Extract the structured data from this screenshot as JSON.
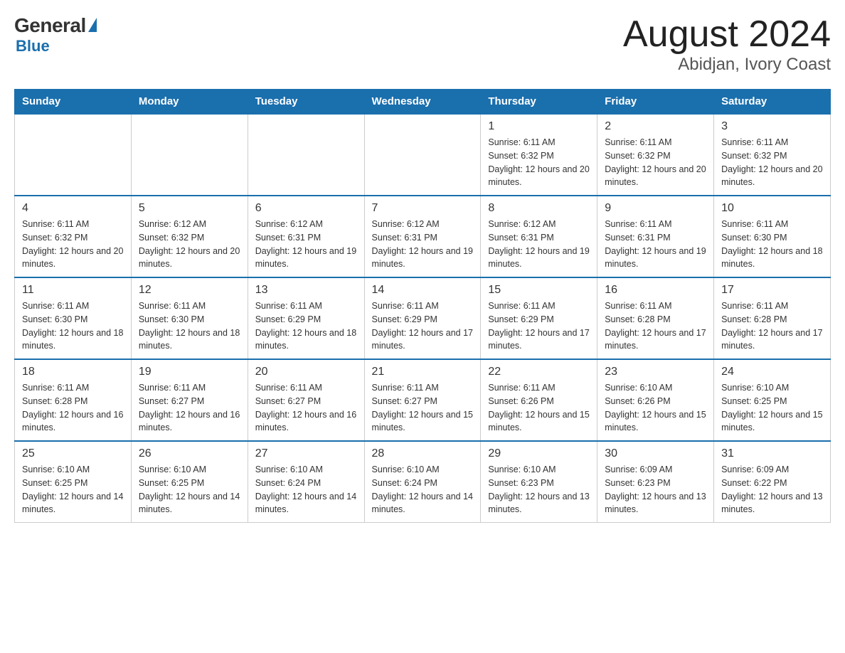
{
  "header": {
    "logo_general": "General",
    "logo_blue": "Blue",
    "month_title": "August 2024",
    "location": "Abidjan, Ivory Coast"
  },
  "calendar": {
    "days_of_week": [
      "Sunday",
      "Monday",
      "Tuesday",
      "Wednesday",
      "Thursday",
      "Friday",
      "Saturday"
    ],
    "weeks": [
      {
        "days": [
          {
            "number": "",
            "info": ""
          },
          {
            "number": "",
            "info": ""
          },
          {
            "number": "",
            "info": ""
          },
          {
            "number": "",
            "info": ""
          },
          {
            "number": "1",
            "info": "Sunrise: 6:11 AM\nSunset: 6:32 PM\nDaylight: 12 hours and 20 minutes."
          },
          {
            "number": "2",
            "info": "Sunrise: 6:11 AM\nSunset: 6:32 PM\nDaylight: 12 hours and 20 minutes."
          },
          {
            "number": "3",
            "info": "Sunrise: 6:11 AM\nSunset: 6:32 PM\nDaylight: 12 hours and 20 minutes."
          }
        ]
      },
      {
        "days": [
          {
            "number": "4",
            "info": "Sunrise: 6:11 AM\nSunset: 6:32 PM\nDaylight: 12 hours and 20 minutes."
          },
          {
            "number": "5",
            "info": "Sunrise: 6:12 AM\nSunset: 6:32 PM\nDaylight: 12 hours and 20 minutes."
          },
          {
            "number": "6",
            "info": "Sunrise: 6:12 AM\nSunset: 6:31 PM\nDaylight: 12 hours and 19 minutes."
          },
          {
            "number": "7",
            "info": "Sunrise: 6:12 AM\nSunset: 6:31 PM\nDaylight: 12 hours and 19 minutes."
          },
          {
            "number": "8",
            "info": "Sunrise: 6:12 AM\nSunset: 6:31 PM\nDaylight: 12 hours and 19 minutes."
          },
          {
            "number": "9",
            "info": "Sunrise: 6:11 AM\nSunset: 6:31 PM\nDaylight: 12 hours and 19 minutes."
          },
          {
            "number": "10",
            "info": "Sunrise: 6:11 AM\nSunset: 6:30 PM\nDaylight: 12 hours and 18 minutes."
          }
        ]
      },
      {
        "days": [
          {
            "number": "11",
            "info": "Sunrise: 6:11 AM\nSunset: 6:30 PM\nDaylight: 12 hours and 18 minutes."
          },
          {
            "number": "12",
            "info": "Sunrise: 6:11 AM\nSunset: 6:30 PM\nDaylight: 12 hours and 18 minutes."
          },
          {
            "number": "13",
            "info": "Sunrise: 6:11 AM\nSunset: 6:29 PM\nDaylight: 12 hours and 18 minutes."
          },
          {
            "number": "14",
            "info": "Sunrise: 6:11 AM\nSunset: 6:29 PM\nDaylight: 12 hours and 17 minutes."
          },
          {
            "number": "15",
            "info": "Sunrise: 6:11 AM\nSunset: 6:29 PM\nDaylight: 12 hours and 17 minutes."
          },
          {
            "number": "16",
            "info": "Sunrise: 6:11 AM\nSunset: 6:28 PM\nDaylight: 12 hours and 17 minutes."
          },
          {
            "number": "17",
            "info": "Sunrise: 6:11 AM\nSunset: 6:28 PM\nDaylight: 12 hours and 17 minutes."
          }
        ]
      },
      {
        "days": [
          {
            "number": "18",
            "info": "Sunrise: 6:11 AM\nSunset: 6:28 PM\nDaylight: 12 hours and 16 minutes."
          },
          {
            "number": "19",
            "info": "Sunrise: 6:11 AM\nSunset: 6:27 PM\nDaylight: 12 hours and 16 minutes."
          },
          {
            "number": "20",
            "info": "Sunrise: 6:11 AM\nSunset: 6:27 PM\nDaylight: 12 hours and 16 minutes."
          },
          {
            "number": "21",
            "info": "Sunrise: 6:11 AM\nSunset: 6:27 PM\nDaylight: 12 hours and 15 minutes."
          },
          {
            "number": "22",
            "info": "Sunrise: 6:11 AM\nSunset: 6:26 PM\nDaylight: 12 hours and 15 minutes."
          },
          {
            "number": "23",
            "info": "Sunrise: 6:10 AM\nSunset: 6:26 PM\nDaylight: 12 hours and 15 minutes."
          },
          {
            "number": "24",
            "info": "Sunrise: 6:10 AM\nSunset: 6:25 PM\nDaylight: 12 hours and 15 minutes."
          }
        ]
      },
      {
        "days": [
          {
            "number": "25",
            "info": "Sunrise: 6:10 AM\nSunset: 6:25 PM\nDaylight: 12 hours and 14 minutes."
          },
          {
            "number": "26",
            "info": "Sunrise: 6:10 AM\nSunset: 6:25 PM\nDaylight: 12 hours and 14 minutes."
          },
          {
            "number": "27",
            "info": "Sunrise: 6:10 AM\nSunset: 6:24 PM\nDaylight: 12 hours and 14 minutes."
          },
          {
            "number": "28",
            "info": "Sunrise: 6:10 AM\nSunset: 6:24 PM\nDaylight: 12 hours and 14 minutes."
          },
          {
            "number": "29",
            "info": "Sunrise: 6:10 AM\nSunset: 6:23 PM\nDaylight: 12 hours and 13 minutes."
          },
          {
            "number": "30",
            "info": "Sunrise: 6:09 AM\nSunset: 6:23 PM\nDaylight: 12 hours and 13 minutes."
          },
          {
            "number": "31",
            "info": "Sunrise: 6:09 AM\nSunset: 6:22 PM\nDaylight: 12 hours and 13 minutes."
          }
        ]
      }
    ]
  }
}
